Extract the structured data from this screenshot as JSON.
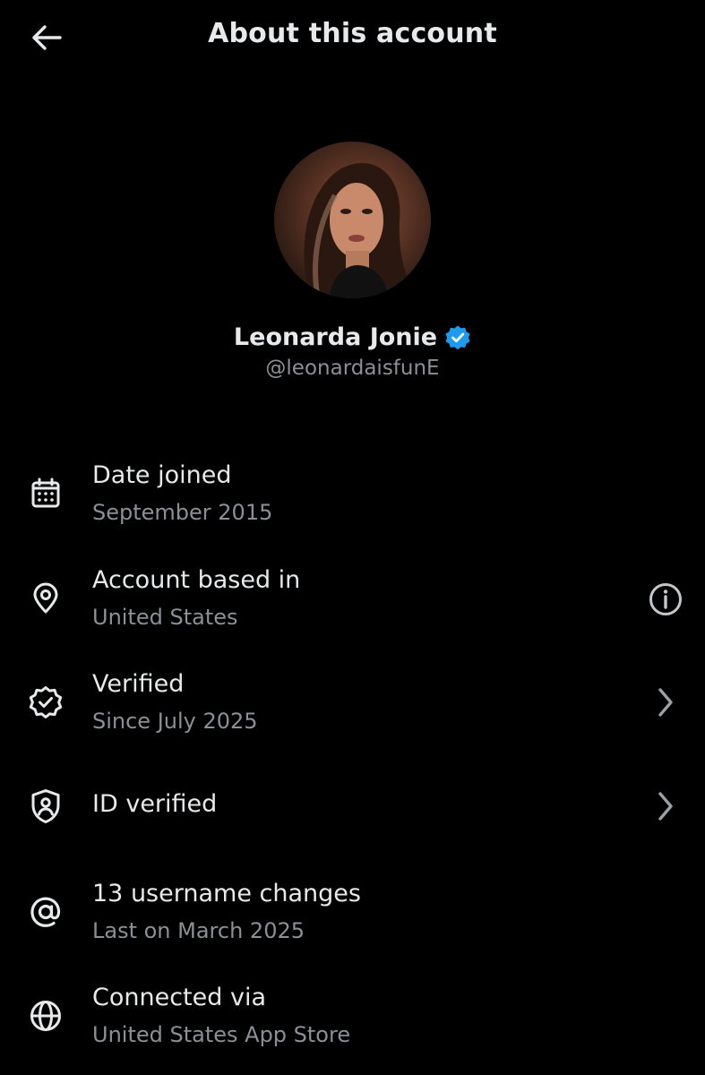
{
  "header": {
    "title": "About this account"
  },
  "profile": {
    "display_name": "Leonarda Jonie",
    "handle": "@leonardaisfunE",
    "verified_color": "#1d9bf0"
  },
  "rows": [
    {
      "icon": "calendar-icon",
      "title": "Date joined",
      "subtitle": "September 2015"
    },
    {
      "icon": "location-pin-icon",
      "title": "Account based in",
      "subtitle": "United States",
      "action_icon": "info-icon"
    },
    {
      "icon": "verified-badge-icon",
      "title": "Verified",
      "subtitle": "Since July 2025",
      "action_icon": "chevron-right-icon"
    },
    {
      "icon": "id-shield-icon",
      "title": "ID verified",
      "action_icon": "chevron-right-icon"
    },
    {
      "icon": "at-sign-icon",
      "title": "13 username changes",
      "subtitle": "Last on March 2025"
    },
    {
      "icon": "globe-icon",
      "title": "Connected via",
      "subtitle": "United States App Store"
    }
  ],
  "colors": {
    "background": "#000000",
    "text_primary": "#e7e9ea",
    "text_secondary": "#8b9096"
  }
}
